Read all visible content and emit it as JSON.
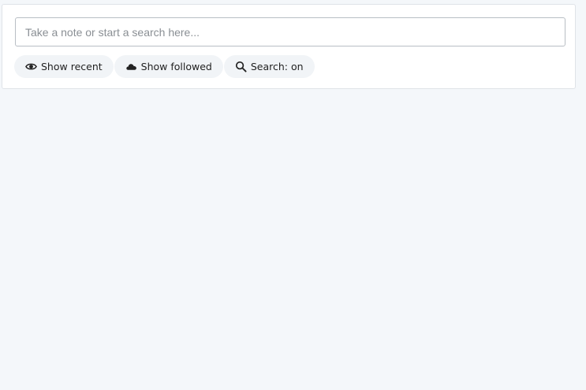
{
  "search": {
    "placeholder": "Take a note or start a search here...",
    "value": ""
  },
  "chips": {
    "show_recent": {
      "label": "Show recent",
      "icon": "eye-icon"
    },
    "show_followed": {
      "label": "Show followed",
      "icon": "cloud-icon"
    },
    "search_toggle": {
      "label": "Search: on",
      "icon": "search-icon"
    }
  },
  "colors": {
    "page_background": "#f4f7fa",
    "card_background": "#ffffff",
    "chip_background": "#f1f4f7"
  }
}
